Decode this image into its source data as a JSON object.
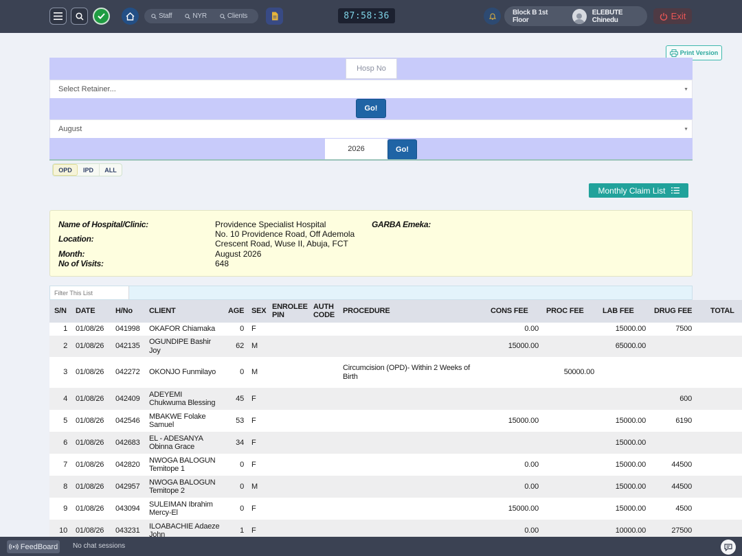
{
  "topbar": {
    "nav_pills": [
      "Staff",
      "NYR",
      "Clients"
    ],
    "clock": "87:58:36",
    "location": "Block B 1st Floor",
    "user_name": "ELEBUTE Chinedu",
    "exit_label": "Exit"
  },
  "toolbar": {
    "print_label": "Print Version"
  },
  "form": {
    "hosp_no_placeholder": "Hosp No",
    "retainer_placeholder": "Select Retainer...",
    "go_label": "Go!",
    "month_value": "August",
    "year_value": "2026"
  },
  "tabs": [
    "OPD",
    "IPD",
    "ALL"
  ],
  "monthly_claim_label": "Monthly Claim List",
  "info": {
    "hospital_label": "Name of Hospital/Clinic:",
    "hospital_value": "Providence Specialist Hospital",
    "location_label": "Location:",
    "location_lines": [
      "No. 10 Providence Road, Off Ademola",
      "Crescent Road, Wuse II, Abuja, FCT"
    ],
    "month_label": "Month:",
    "month_value": "August 2026",
    "visits_label": "No of Visits:",
    "visits_value": "648",
    "extra_name": "GARBA Emeka:"
  },
  "filter": {
    "placeholder": "Filter This List"
  },
  "table": {
    "headers": [
      "S/N",
      "DATE",
      "H/No",
      "CLIENT",
      "AGE",
      "SEX",
      "ENROLEE PIN",
      "AUTH CODE",
      "PROCEDURE",
      "CONS FEE",
      "PROC FEE",
      "LAB FEE",
      "DRUG FEE",
      "TOTAL"
    ],
    "rows": [
      {
        "sn": "1",
        "date": "01/08/26",
        "hno": "041998",
        "client": [
          "OKAFOR Chiamaka"
        ],
        "age": "0",
        "sex": "F",
        "procedure": [],
        "cons": "0.00",
        "proc": "",
        "lab": "15000.00",
        "drug": "7500"
      },
      {
        "sn": "2",
        "date": "01/08/26",
        "hno": "042135",
        "client": [
          "OGUNDIPE Bashir",
          "Joy"
        ],
        "age": "62",
        "sex": "M",
        "procedure": [],
        "cons": "15000.00",
        "proc": "",
        "lab": "65000.00",
        "drug": ""
      },
      {
        "sn": "3",
        "date": "01/08/26",
        "hno": "042272",
        "client": [
          "OKONJO Funmilayo"
        ],
        "age": "0",
        "sex": "M",
        "procedure": [
          "Circumcision (OPD)- Within 2 Weeks of",
          "Birth"
        ],
        "cons": "",
        "proc": "50000.00",
        "lab": "",
        "drug": ""
      },
      {
        "sn": "4",
        "date": "01/08/26",
        "hno": "042409",
        "client": [
          "ADEYEMI",
          "Chukwuma Blessing"
        ],
        "age": "45",
        "sex": "F",
        "procedure": [],
        "cons": "",
        "proc": "",
        "lab": "",
        "drug": "600"
      },
      {
        "sn": "5",
        "date": "01/08/26",
        "hno": "042546",
        "client": [
          "MBAKWE Folake",
          "Samuel"
        ],
        "age": "53",
        "sex": "F",
        "procedure": [],
        "cons": "15000.00",
        "proc": "",
        "lab": "15000.00",
        "drug": "6190"
      },
      {
        "sn": "6",
        "date": "01/08/26",
        "hno": "042683",
        "client": [
          "EL - ADESANYA",
          "Obinna Grace"
        ],
        "age": "34",
        "sex": "F",
        "procedure": [],
        "cons": "",
        "proc": "",
        "lab": "15000.00",
        "drug": ""
      },
      {
        "sn": "7",
        "date": "01/08/26",
        "hno": "042820",
        "client": [
          "NWOGA BALOGUN",
          "Temitope 1"
        ],
        "age": "0",
        "sex": "F",
        "procedure": [],
        "cons": "0.00",
        "proc": "",
        "lab": "15000.00",
        "drug": "44500"
      },
      {
        "sn": "8",
        "date": "01/08/26",
        "hno": "042957",
        "client": [
          "NWOGA BALOGUN",
          "Temitope 2"
        ],
        "age": "0",
        "sex": "M",
        "procedure": [],
        "cons": "0.00",
        "proc": "",
        "lab": "15000.00",
        "drug": "44500"
      },
      {
        "sn": "9",
        "date": "01/08/26",
        "hno": "043094",
        "client": [
          "SULEIMAN Ibrahim",
          "Mercy-El"
        ],
        "age": "0",
        "sex": "F",
        "procedure": [],
        "cons": "15000.00",
        "proc": "",
        "lab": "15000.00",
        "drug": "4500"
      },
      {
        "sn": "10",
        "date": "01/08/26",
        "hno": "043231",
        "client": [
          "ILOABACHIE Adaeze",
          "John"
        ],
        "age": "1",
        "sex": "F",
        "procedure": [],
        "cons": "0.00",
        "proc": "",
        "lab": "10000.00",
        "drug": "27500"
      }
    ]
  },
  "footer": {
    "feedboard_label": "FeedBoard",
    "chat_status": "No chat sessions"
  }
}
